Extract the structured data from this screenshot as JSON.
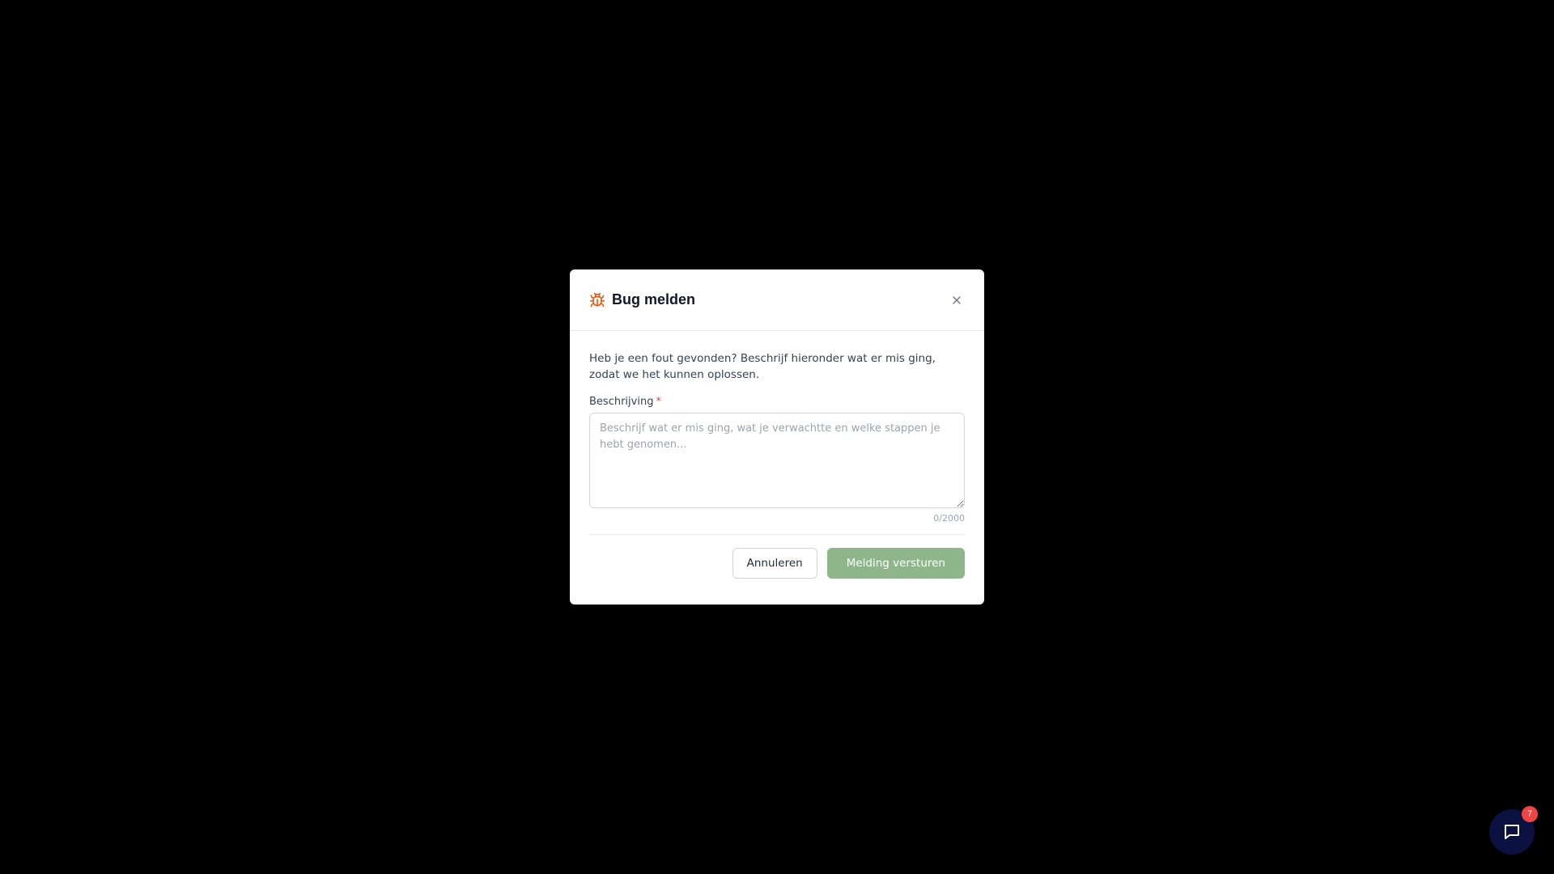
{
  "modal": {
    "title": "Bug melden",
    "intro": "Heb je een fout gevonden? Beschrijf hieronder wat er mis ging, zodat we het kunnen oplossen.",
    "field_label": "Beschrijving",
    "required_marker": "*",
    "textarea": {
      "value": "",
      "placeholder": "Beschrijf wat er mis ging, wat je verwachtte en welke stappen je hebt genomen..."
    },
    "counter": "0/2000",
    "cancel_label": "Annuleren",
    "submit_label": "Melding versturen"
  },
  "chat": {
    "badge_count": "7"
  },
  "icons": {
    "header": "bug-icon",
    "close": "close-icon",
    "chat": "chat-icon"
  },
  "colors": {
    "bug_icon": "#ea580c",
    "submit_button": "#8fb58b",
    "required": "#ef4444",
    "chat_launcher": "#0b1140",
    "badge": "#ef4444"
  }
}
